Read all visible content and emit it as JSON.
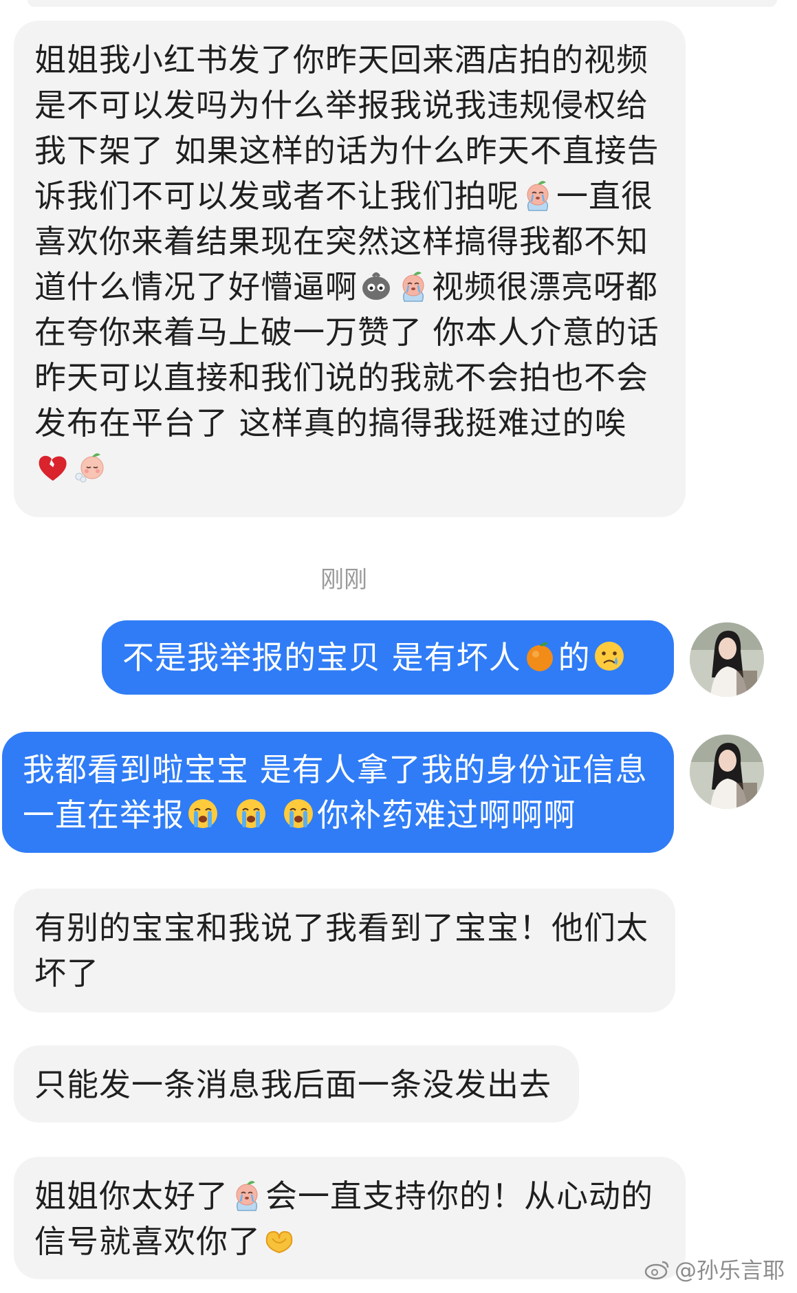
{
  "messages": {
    "m1": {
      "p1": "姐姐我小红书发了你昨天回来酒店拍的视频是不可以发吗为什么举报我说我违规侵权给我下架了 如果这样的话为什么昨天不直接告诉我们不可以发或者不让我们拍呢",
      "p2": "一直很喜欢你来着结果现在突然这样搞得我都不知道什么情况了好懵逼啊",
      "p3": "视频很漂亮呀都在夸你来着马上破一万赞了 你本人介意的话昨天可以直接和我们说的我就不会拍也不会发布在平台了 这样真的搞得我挺难过的唉"
    },
    "timestamp": "刚刚",
    "m2": {
      "p1": "不是我举报的宝贝 是有坏人",
      "p2": "的"
    },
    "m3": {
      "p1": "我都看到啦宝宝 是有人拿了我的身份证信息一直在举报",
      "p2": "你补药难过啊啊啊"
    },
    "m4": "有别的宝宝和我说了我看到了宝宝！他们太坏了",
    "m5": "只能发一条消息我后面一条没发出去",
    "m6": {
      "p1": "姐姐你太好了",
      "p2": "会一直支持你的！从心动的信号就喜欢你了"
    }
  },
  "watermark": "@孙乐言耶",
  "icons": [
    "crying-peach-emoji",
    "gray-blob-emoji",
    "broken-heart-emoji",
    "sighing-peach-emoji",
    "orange-emoji",
    "crying-face-emoji",
    "loudly-crying-face-emoji",
    "heart-hands-emoji",
    "weibo-logo-icon"
  ],
  "colors": {
    "incoming_bubble": "#f3f3f3",
    "outgoing_bubble": "#2f7cf6",
    "timestamp": "#9a9a9a"
  }
}
